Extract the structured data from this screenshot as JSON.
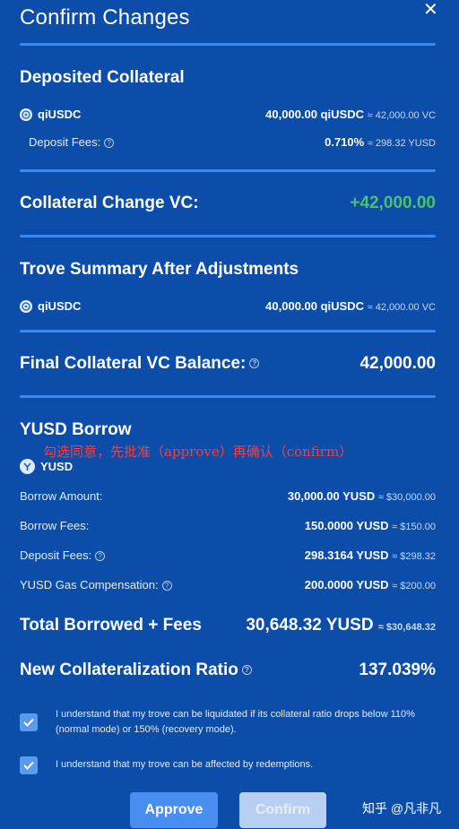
{
  "title": "Confirm Changes",
  "close_label": "✕",
  "deposited": {
    "heading": "Deposited Collateral",
    "token": "qiUSDC",
    "amount": "40,000.00 qiUSDC",
    "amount_approx": "≈ 42,000.00 VC",
    "fee_label": "Deposit Fees:",
    "fee_value": "0.710%",
    "fee_approx": "≈ 298.32 YUSD"
  },
  "collateral_change": {
    "label": "Collateral Change VC:",
    "value": "+42,000.00"
  },
  "trove_summary": {
    "heading": "Trove Summary After Adjustments",
    "token": "qiUSDC",
    "amount": "40,000.00 qiUSDC",
    "amount_approx": "≈ 42,000.00 VC"
  },
  "final_balance": {
    "label": "Final Collateral VC Balance:",
    "value": "42,000.00"
  },
  "borrow": {
    "heading": "YUSD Borrow",
    "token": "YUSD",
    "annotation": "勾选同意，先批准（approve）再确认（confirm）",
    "rows": [
      {
        "label": "Borrow Amount:",
        "value": "30,000.00 YUSD",
        "approx": "≈ $30,000.00"
      },
      {
        "label": "Borrow Fees:",
        "value": "150.0000 YUSD",
        "approx": "≈ $150.00"
      },
      {
        "label": "Deposit Fees:",
        "value": "298.3164 YUSD",
        "approx": "≈ $298.32"
      },
      {
        "label": "YUSD Gas Compensation:",
        "value": "200.0000 YUSD",
        "approx": "≈ $200.00"
      }
    ]
  },
  "total": {
    "label": "Total Borrowed + Fees",
    "value": "30,648.32 YUSD",
    "approx": "≈ $30,648.32"
  },
  "ratio": {
    "label": "New Collateralization Ratio",
    "value": "137.039%"
  },
  "checkboxes": [
    {
      "text": "I understand that my trove can be liquidated if its collateral ratio drops below 110% (normal mode) or 150% (recovery mode).",
      "checked": true
    },
    {
      "text": "I understand that my trove can be affected by redemptions.",
      "checked": true
    }
  ],
  "buttons": {
    "approve": "Approve",
    "confirm": "Confirm"
  },
  "watermark": "知乎 @凡非凡",
  "colors": {
    "background": "#0b4da8",
    "divider": "#3c8af0",
    "positive": "#4cc26b",
    "annotation": "#ff3b3b"
  }
}
